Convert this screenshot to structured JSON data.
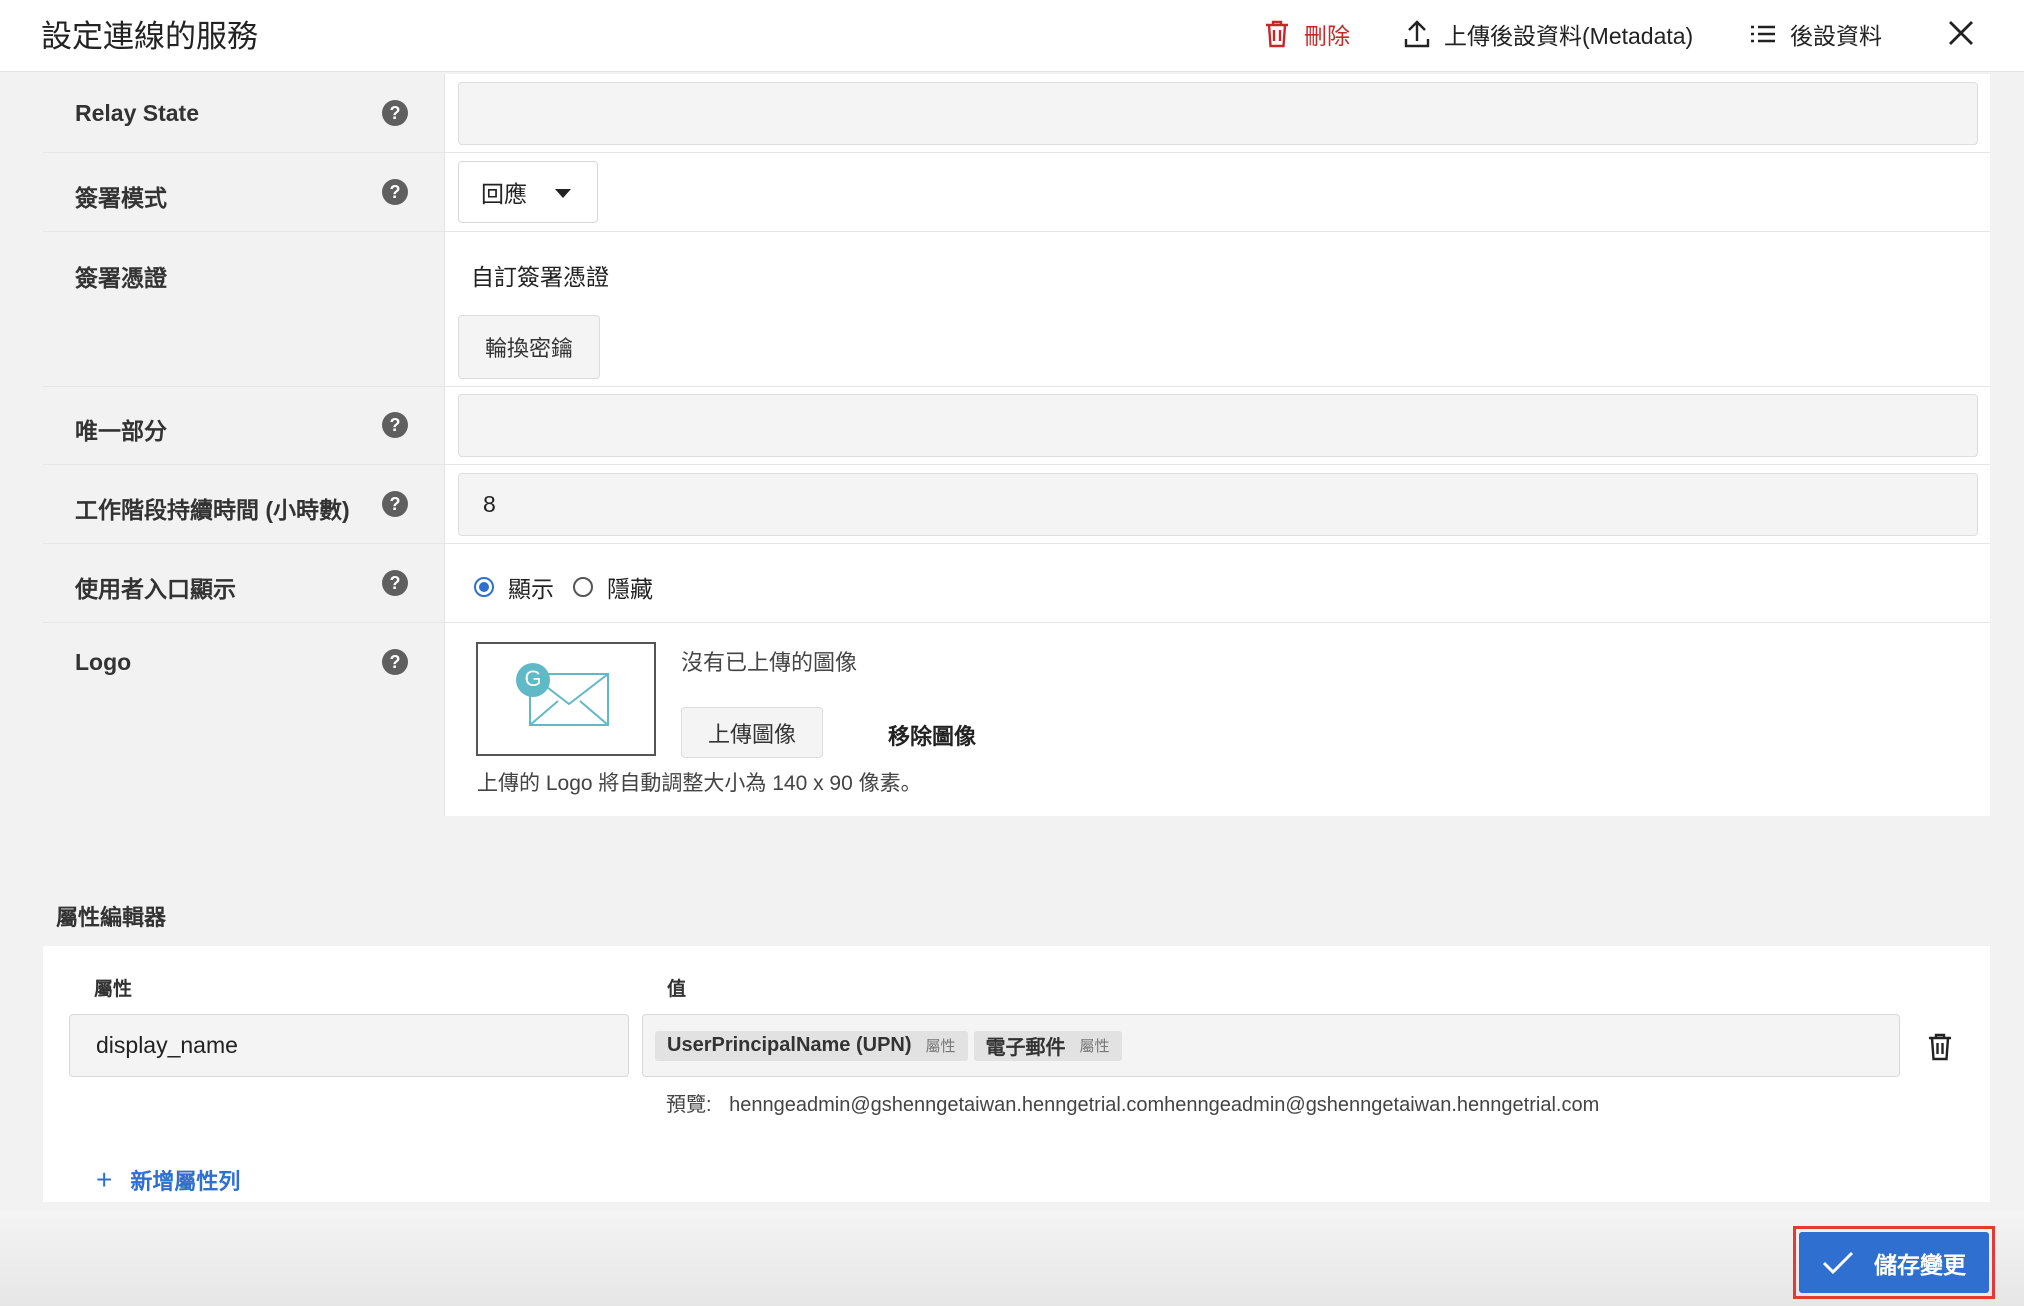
{
  "header": {
    "title": "設定連線的服務",
    "delete_label": "刪除",
    "upload_label": "上傳後設資料(Metadata)",
    "metadata_label": "後設資料"
  },
  "settings": {
    "relay_state": {
      "label": "Relay State",
      "value": ""
    },
    "signing_mode": {
      "label": "簽署模式",
      "selected": "回應"
    },
    "signing_cert": {
      "label": "簽署憑證",
      "value": "自訂簽署憑證",
      "rotate_button": "輪換密鑰"
    },
    "unique_part": {
      "label": "唯一部分",
      "value": ""
    },
    "session_duration": {
      "label": "工作階段持續時間 (小時數)",
      "value": "8"
    },
    "portal_display": {
      "label": "使用者入口顯示",
      "options": [
        "顯示",
        "隱藏"
      ],
      "selected": "顯示"
    },
    "logo": {
      "label": "Logo",
      "badge_letter": "G",
      "no_image_text": "沒有已上傳的圖像",
      "upload_button": "上傳圖像",
      "remove_button": "移除圖像",
      "hint": "上傳的 Logo 將自動調整大小為 140 x 90 像素。"
    }
  },
  "attribute_editor": {
    "title": "屬性編輯器",
    "col_attribute": "屬性",
    "col_value": "值",
    "rows": [
      {
        "attribute": "display_name",
        "chips": [
          {
            "label": "UserPrincipalName (UPN)",
            "type": "屬性"
          },
          {
            "label": "電子郵件",
            "type": "屬性"
          }
        ],
        "preview_label": "預覽:",
        "preview_value": "henngeadmin@gshenngetaiwan.henngetrial.comhenngeadmin@gshenngetaiwan.henngetrial.com"
      }
    ],
    "add_row": "新增屬性列"
  },
  "footer": {
    "save_label": "儲存變更"
  },
  "colors": {
    "accent": "#2f6fcf",
    "danger": "#c62828",
    "highlight": "#e53935",
    "logo_teal": "#5fb9c6"
  }
}
